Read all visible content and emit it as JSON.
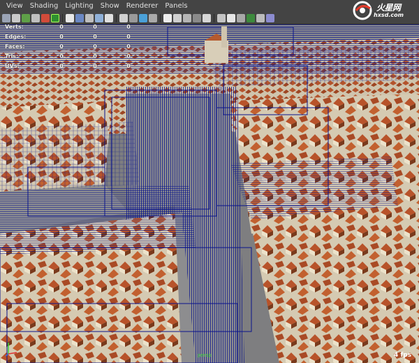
{
  "menu": [
    "View",
    "Shading",
    "Lighting",
    "Show",
    "Renderer",
    "Panels"
  ],
  "toolbar_icons": [
    "select-camera",
    "camera-attributes",
    "bookmark",
    "image-plane",
    "grid",
    "film-gate",
    "resolution-gate",
    "field-chart",
    "safe-action",
    "safe-title",
    "wireframe",
    "smooth-shade",
    "wireframe-on-shaded",
    "textured",
    "use-all-lights",
    "shadows",
    "xray",
    "xray-joints",
    "isolate-select",
    "high-quality",
    "bounding-box",
    "points",
    "lighting-mode",
    "isolate",
    "texture-placement",
    "render-view"
  ],
  "hud": {
    "rows": [
      {
        "label": "Verts:",
        "values": [
          "0",
          "0",
          "0"
        ]
      },
      {
        "label": "Edges:",
        "values": [
          "0",
          "0",
          "0"
        ]
      },
      {
        "label": "Faces:",
        "values": [
          "0",
          "0",
          "0"
        ]
      },
      {
        "label": "Tris:",
        "values": [
          "0",
          "0",
          "0"
        ]
      },
      {
        "label": "UVs:",
        "values": [
          "0",
          "0",
          "0"
        ]
      }
    ]
  },
  "camera_name": "persp",
  "fps": "4 fps",
  "watermark": {
    "brand": "火星网",
    "url": "hxsd.com"
  },
  "colors": {
    "wireframe": "#0a148c",
    "roof": "#b8532a",
    "wall": "#d9cfb8",
    "ground": "#8a8a8a",
    "panel": "#444444"
  }
}
